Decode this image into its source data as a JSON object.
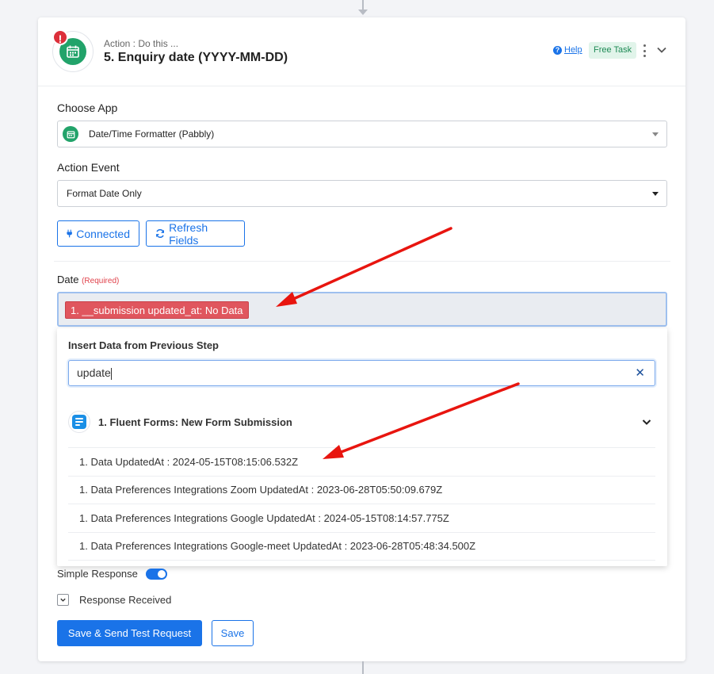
{
  "step": {
    "action_label": "Action : Do this ...",
    "title": "5. Enquiry date (YYYY-MM-DD)",
    "alert": "!",
    "help_label": "Help",
    "help_glyph": "?",
    "badge": "Free Task"
  },
  "choose_app": {
    "label": "Choose App",
    "value": "Date/Time Formatter (Pabbly)"
  },
  "action_event": {
    "label": "Action Event",
    "value": "Format Date Only"
  },
  "buttons": {
    "connected": "Connected",
    "refresh": "Refresh Fields",
    "send_test": "Save & Send Test Request",
    "save": "Save"
  },
  "date_field": {
    "label": "Date",
    "required": "(Required)",
    "chip": "1. __submission updated_at: No Data"
  },
  "insert_data": {
    "title": "Insert Data from Previous Step",
    "search_value": "update",
    "clear_glyph": "✕",
    "group_label": "1. Fluent Forms: New Form Submission",
    "items": [
      "1. Data UpdatedAt : 2024-05-15T08:15:06.532Z",
      "1. Data Preferences Integrations Zoom UpdatedAt : 2023-06-28T05:50:09.679Z",
      "1. Data Preferences Integrations Google UpdatedAt : 2024-05-15T08:14:57.775Z",
      "1. Data Preferences Integrations Google-meet UpdatedAt : 2023-06-28T05:48:34.500Z"
    ]
  },
  "options": {
    "simple_response": "Simple Response",
    "response_received": "Response Received"
  },
  "icons": {
    "app": "calendar-icon",
    "connected": "plug-icon",
    "refresh": "refresh-icon",
    "group": "fluent-forms-icon"
  },
  "colors": {
    "primary": "#1a73e8",
    "app_green": "#22a36a",
    "alert_red": "#dc2f3a",
    "chip_red": "#e0565e",
    "annotation_arrow": "#e8150f"
  }
}
